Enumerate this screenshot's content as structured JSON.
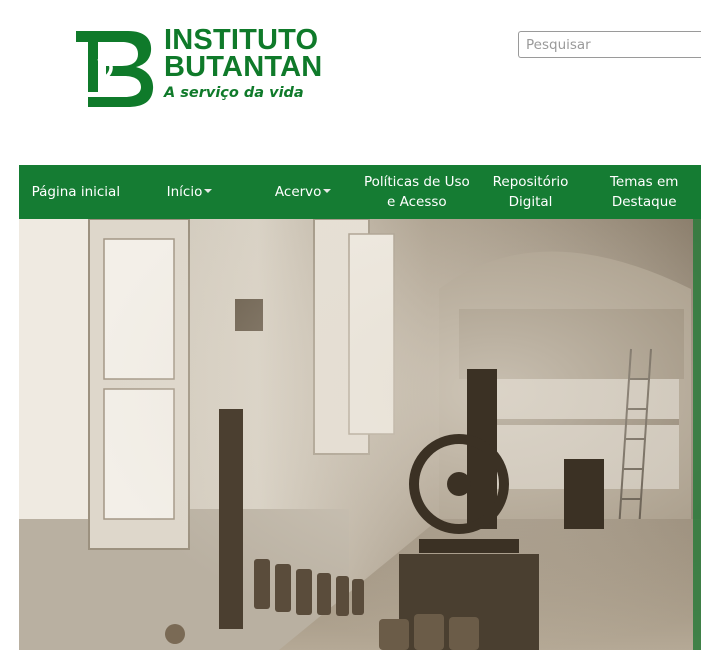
{
  "brand": {
    "line1": "INSTITUTO",
    "line2": "BUTANTAN",
    "tagline": "A serviço da vida",
    "color": "#0f7a2a"
  },
  "search": {
    "placeholder": "Pesquisar"
  },
  "nav": {
    "background": "#157c33",
    "items": [
      {
        "label": "Página inicial"
      },
      {
        "label": "Início",
        "dropdown": true
      },
      {
        "label": "Acervo",
        "dropdown": true
      },
      {
        "label": "Políticas de Uso e Acesso"
      },
      {
        "label": "Repositório Digital"
      },
      {
        "label": "Temas em Destaque"
      }
    ]
  },
  "hero": {
    "icon": "historic-laboratory-photo",
    "tone": "sepia"
  }
}
